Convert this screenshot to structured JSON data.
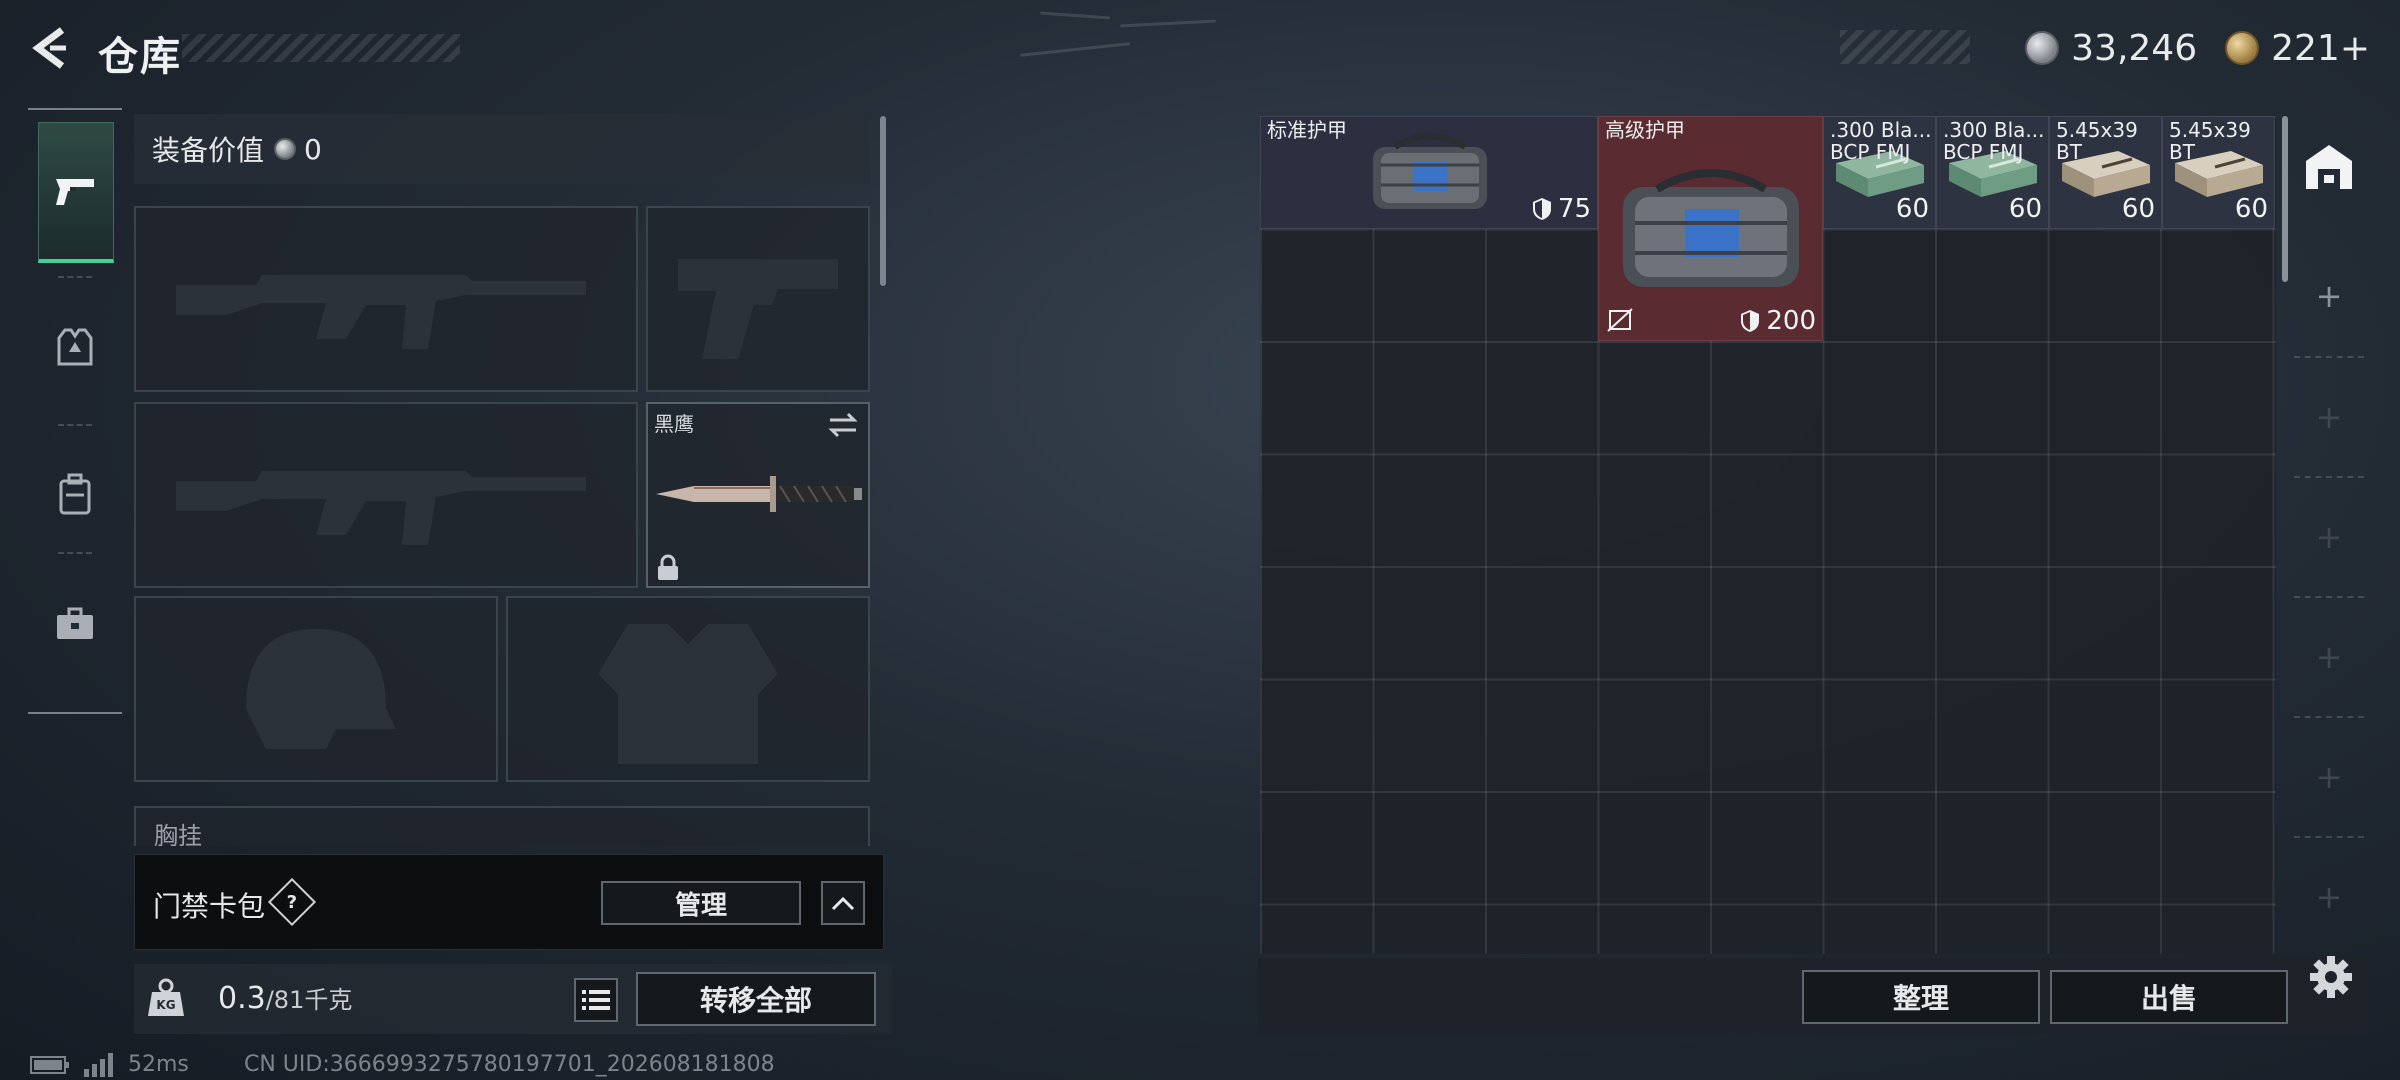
{
  "header": {
    "title": "仓库",
    "back_icon": "back-arrow-icon",
    "currency": [
      {
        "icon": "silver-coin-icon",
        "value": "33,246"
      },
      {
        "icon": "gold-coin-icon",
        "value": "221+"
      }
    ]
  },
  "side_nav": [
    {
      "icon": "pistol-icon",
      "active": true
    },
    {
      "icon": "armor-vest-icon",
      "active": false
    },
    {
      "icon": "backpack-icon",
      "active": false
    },
    {
      "icon": "toolbox-icon",
      "active": false
    }
  ],
  "equipment": {
    "value_label": "装备价值",
    "value": "0",
    "slots": [
      {
        "id": "primary-weapon-1",
        "name": "",
        "icon": "rifle-silhouette-icon",
        "empty": true
      },
      {
        "id": "pistol",
        "name": "",
        "icon": "pistol-silhouette-icon",
        "empty": true
      },
      {
        "id": "primary-weapon-2",
        "name": "",
        "icon": "rifle-silhouette-icon",
        "empty": true
      },
      {
        "id": "melee",
        "name": "黑鹰",
        "icon": "knife-icon",
        "empty": false,
        "locked": true,
        "swappable": true
      },
      {
        "id": "helmet",
        "name": "",
        "icon": "helmet-silhouette-icon",
        "empty": true
      },
      {
        "id": "body-armor",
        "name": "",
        "icon": "vest-silhouette-icon",
        "empty": true
      }
    ],
    "partial_label": "胸挂"
  },
  "keycard": {
    "title": "门禁卡包",
    "help": "?",
    "manage_label": "管理"
  },
  "weight": {
    "current": "0.3",
    "max": "/81千克",
    "transfer_label": "转移全部"
  },
  "status": {
    "ping": "52ms",
    "uid": "CN UID:3666993275780197701_202608181808"
  },
  "storage": {
    "items": [
      {
        "name": "标准护甲",
        "armor": "75",
        "icon": "armor-bag-icon",
        "color": "#2c2f3f"
      },
      {
        "name": "高级护甲",
        "armor": "200",
        "icon": "armor-bag-icon",
        "color": "#5a2b31"
      },
      {
        "name": ".300 Bla...\nBCP FMJ",
        "qty": "60",
        "icon": "ammo-box-green-icon",
        "color": "#2e3342"
      },
      {
        "name": ".300 Bla...\nBCP FMJ",
        "qty": "60",
        "icon": "ammo-box-green-icon",
        "color": "#2e3342"
      },
      {
        "name": "5.45x39\nBT",
        "qty": "60",
        "icon": "ammo-box-tan-icon",
        "color": "#2e3342"
      },
      {
        "name": "5.45x39\nBT",
        "qty": "60",
        "icon": "ammo-box-tan-icon",
        "color": "#2e3342"
      }
    ],
    "sort_label": "整理",
    "sell_label": "出售"
  },
  "right_rail": {
    "top_icon": "storage-warehouse-icon",
    "plus_symbol": "+",
    "settings_icon": "gear-icon"
  }
}
